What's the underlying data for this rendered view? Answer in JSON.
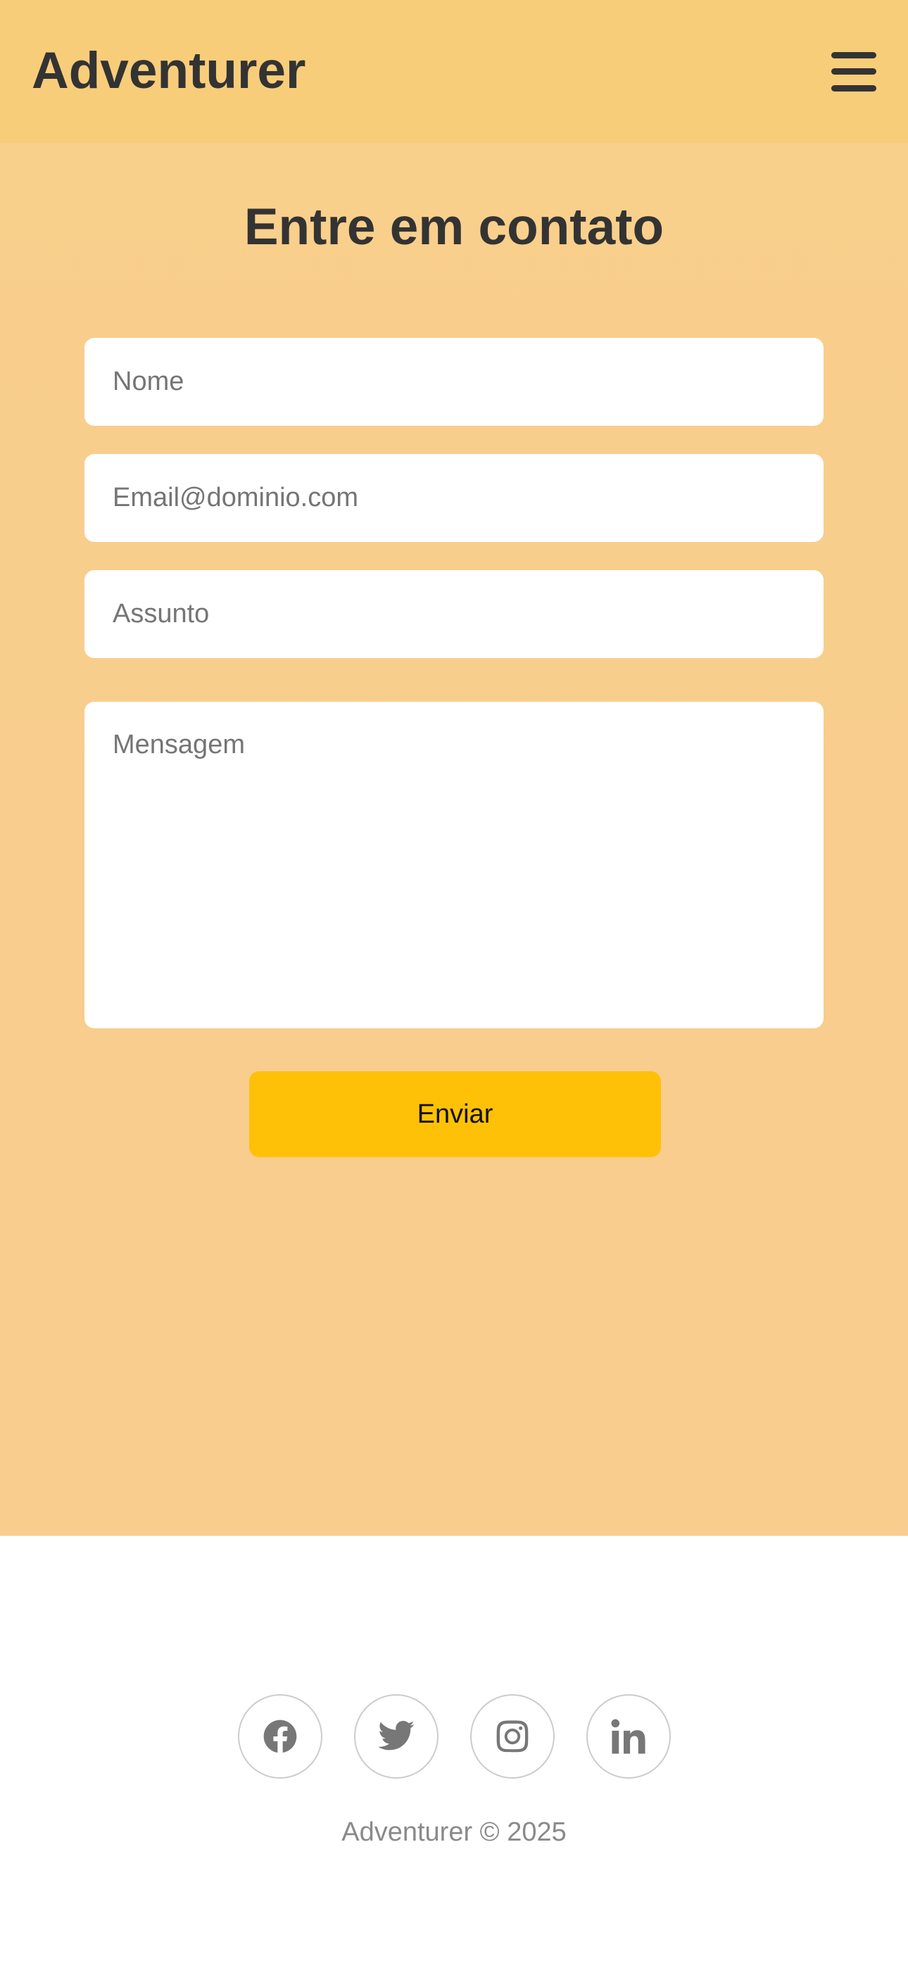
{
  "header": {
    "brand": "Adventurer",
    "menu_icon": "hamburger-menu-icon"
  },
  "contact": {
    "title": "Entre em contato",
    "fields": {
      "name_placeholder": "Nome",
      "email_placeholder": "Email@dominio.com",
      "subject_placeholder": "Assunto",
      "message_placeholder": "Mensagem"
    },
    "submit_label": "Enviar"
  },
  "footer": {
    "social": [
      {
        "icon": "facebook-icon"
      },
      {
        "icon": "twitter-icon"
      },
      {
        "icon": "instagram-icon"
      },
      {
        "icon": "linkedin-icon"
      }
    ],
    "copyright": "Adventurer © 2025"
  },
  "colors": {
    "header_bg": "#f8cd7a",
    "main_bg": "#f9cf8c",
    "accent_button": "#ffc107",
    "text_dark": "#333333"
  }
}
